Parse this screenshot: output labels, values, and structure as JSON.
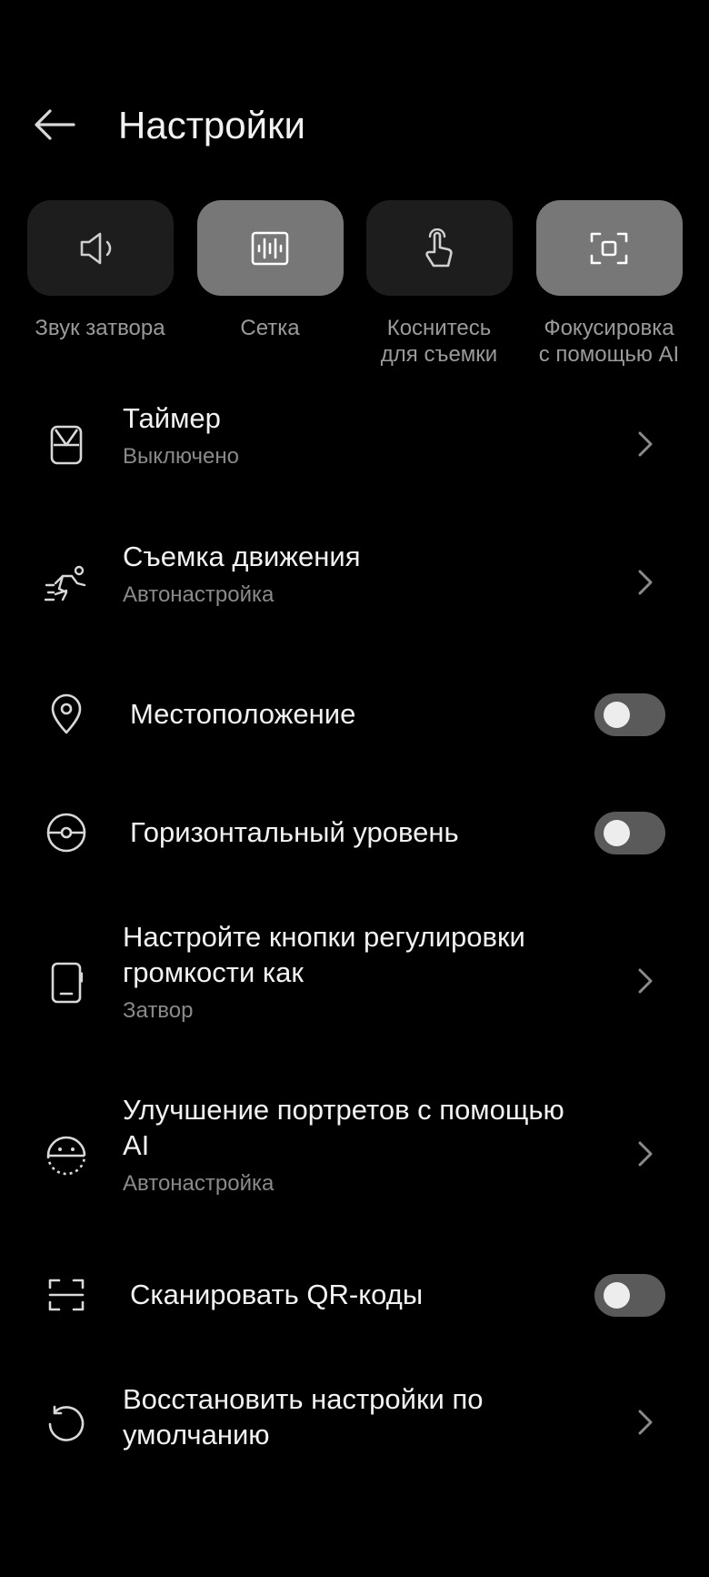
{
  "header": {
    "title": "Настройки",
    "back_icon": "arrow-left-icon"
  },
  "quick_settings": [
    {
      "id": "shutter-sound",
      "label": "Звук затвора",
      "icon": "speaker-icon",
      "active": false
    },
    {
      "id": "grid",
      "label": "Сетка",
      "icon": "grid-icon",
      "active": true
    },
    {
      "id": "touch-shoot",
      "label": "Коснитесь\nдля съемки",
      "icon": "touch-icon",
      "active": false
    },
    {
      "id": "ai-focus",
      "label": "Фокусировка\nс помощью AI",
      "icon": "focus-frame-icon",
      "active": true
    }
  ],
  "settings": [
    {
      "id": "timer",
      "title": "Таймер",
      "subtitle": "Выключено",
      "icon": "hourglass-icon",
      "control": "chevron"
    },
    {
      "id": "motion",
      "title": "Съемка движения",
      "subtitle": "Автонастройка",
      "icon": "running-icon",
      "control": "chevron"
    },
    {
      "id": "location",
      "title": "Местоположение",
      "icon": "location-pin-icon",
      "control": "toggle",
      "checked": false
    },
    {
      "id": "level",
      "title": "Горизонтальный уровень",
      "icon": "level-icon",
      "control": "toggle",
      "checked": false
    },
    {
      "id": "volume-keys",
      "title": "Настройте кнопки регулировки громкости как",
      "subtitle": "Затвор",
      "icon": "phone-volume-icon",
      "control": "chevron"
    },
    {
      "id": "portrait-ai",
      "title": "Улучшение портретов с помощью AI",
      "subtitle": "Автонастройка",
      "icon": "face-icon",
      "control": "chevron"
    },
    {
      "id": "qr",
      "title": "Сканировать QR-коды",
      "icon": "scan-icon",
      "control": "toggle",
      "checked": false
    },
    {
      "id": "reset",
      "title": "Восстановить настройки по умолчанию",
      "icon": "reset-icon",
      "control": "chevron"
    }
  ],
  "colors": {
    "background": "#000000",
    "tile": "#1d1d1d",
    "tile_active": "#777777",
    "toggle_off": "#5a5a5a"
  }
}
